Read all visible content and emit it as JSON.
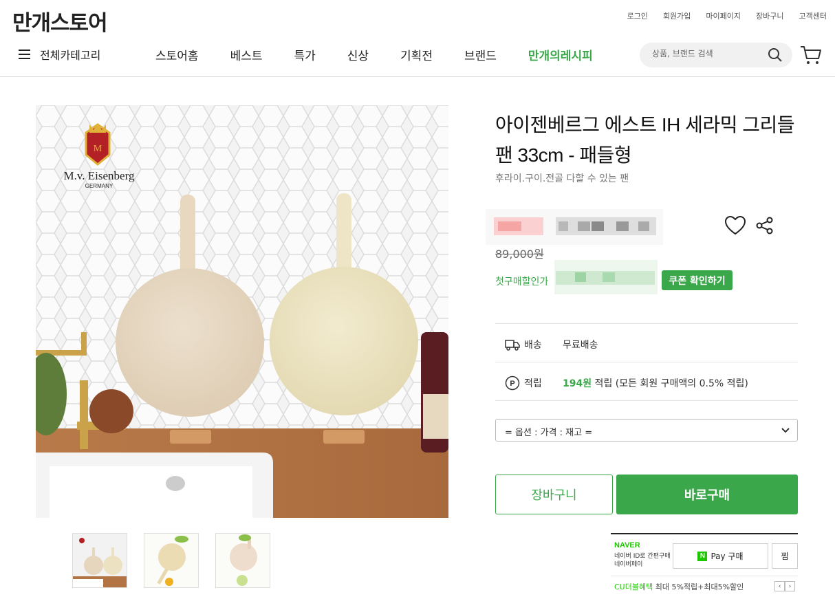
{
  "header": {
    "logo": "만개스토어",
    "util_links": [
      "로그인",
      "회원가입",
      "마이페이지",
      "장바구니",
      "고객센터"
    ],
    "all_category": "전체카테고리",
    "menu": [
      "스토어홈",
      "베스트",
      "특가",
      "신상",
      "기획전",
      "브랜드"
    ],
    "recipe_menu": "만개의레시피",
    "search_placeholder": "상품, 브랜드 검색"
  },
  "image": {
    "brand_name": "M.v. Eisenberg",
    "brand_country": "GERMANY"
  },
  "product": {
    "title": "아이젠베르그 에스트 IH 세라믹 그리들팬 33cm - 패들형",
    "subtitle": "후라이.구이.전골 다할 수 있는 팬",
    "original_price": "89,000원",
    "first_purchase_label": "첫구매할인가",
    "coupon_button": "쿠폰 확인하기",
    "shipping": {
      "label": "배송",
      "value": "무료배송"
    },
    "points": {
      "label": "적립",
      "amount": "194원",
      "desc": " 적립 (모든 회원 구매액의 0.5% 적립)"
    },
    "option_select": "= 옵션 : 가격 : 재고 =",
    "cart_button": "장바구니",
    "buy_button": "바로구매"
  },
  "npay": {
    "logo": "NAVER",
    "desc": "네이버 ID로 간편구매 네이버페이",
    "badge": "N",
    "pay_label": "Pay 구매",
    "zzim": "찜",
    "cu_label": "CU더블혜택",
    "cu_desc": " 최대 5%적립+최대5%할인",
    "prev": "‹",
    "next": "›"
  },
  "colors": {
    "accent": "#3aa84a",
    "naver": "#1ec800"
  },
  "icons": [
    "menu-icon",
    "search-icon",
    "cart-icon",
    "heart-icon",
    "share-icon",
    "truck-icon",
    "point-icon",
    "chevron-down-icon"
  ]
}
